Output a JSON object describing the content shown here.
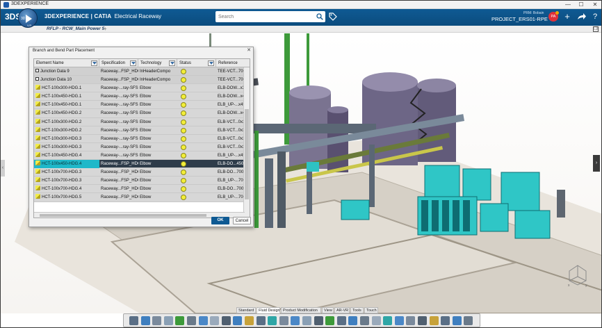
{
  "os": {
    "title": "3DEXPERIENCE",
    "minimize": "—",
    "maximize": "☐",
    "close": "✕"
  },
  "topbar": {
    "logo": "3DS",
    "compass_version": "3D",
    "compass_code": "V.R",
    "brand": "3DEXPERIENCE | CATIA",
    "app_name": "Electrical Raceway",
    "search_placeholder": "Search",
    "role": "PRM: Bobain",
    "project": "PROJECT_ERS01-RPE ▾",
    "avatar_initials": "PA"
  },
  "tab": {
    "title": "RFLP - RCW_Main Power 5",
    "add": "+"
  },
  "dialog": {
    "title": "Branch and Bend Part Placement",
    "close": "✕",
    "columns": [
      "Element Name",
      "Specification",
      "Technology",
      "Status",
      "Reference"
    ],
    "rows": [
      {
        "name": "Junction Data 9",
        "spec": "Raceway...FSP_HDG",
        "tech": "InHeaderCompo",
        "ref": "TEE-VCT...700-",
        "kind": "junction"
      },
      {
        "name": "Junction Data 10",
        "spec": "Raceway...FSP_HDG",
        "tech": "InHeaderCompo",
        "ref": "TEE-VCT...700-",
        "kind": "junction"
      },
      {
        "name": "HCT-100x300-HDG.1",
        "spec": "Raceway-...ray-SFSP",
        "tech": "Elbow",
        "ref": "ELB-DOW...x3(",
        "kind": "elbow"
      },
      {
        "name": "HCT-100x450-HDG.1",
        "spec": "Raceway-...ray-SFSP",
        "tech": "Elbow",
        "ref": "ELB-DOW...x45",
        "kind": "elbow"
      },
      {
        "name": "HCT-100x450-HDG.1",
        "spec": "Raceway-...ray-SFSP",
        "tech": "Elbow",
        "ref": "ELB_UP-...x450",
        "kind": "elbow"
      },
      {
        "name": "HCT-100x450-HDG.2",
        "spec": "Raceway-...ray-SFSP",
        "tech": "Elbow",
        "ref": "ELB-DOW...x45",
        "kind": "elbow"
      },
      {
        "name": "HCT-100x300-HDG.2",
        "spec": "Raceway-...ray-SFSP",
        "tech": "Elbow",
        "ref": "ELB-VCT...0x3C",
        "kind": "elbow"
      },
      {
        "name": "HCT-100x300-HDG.2",
        "spec": "Raceway-...ray-SFSP",
        "tech": "Elbow",
        "ref": "ELB-VCT...0x3C",
        "kind": "elbow"
      },
      {
        "name": "HCT-100x300-HDG.3",
        "spec": "Raceway-...ray-SFSP",
        "tech": "Elbow",
        "ref": "ELB-VCT...0x3C",
        "kind": "elbow"
      },
      {
        "name": "HCT-100x300-HDG.3",
        "spec": "Raceway-...ray-SFSP",
        "tech": "Elbow",
        "ref": "ELB-VCT...0x3C",
        "kind": "elbow"
      },
      {
        "name": "HCT-100x450-HDG.4",
        "spec": "Raceway-...ray-SFSP",
        "tech": "Elbow",
        "ref": "ELB_UP-...x450",
        "kind": "elbow"
      },
      {
        "name": "HCT-100x450-HDG.4",
        "spec": "Raceway...FSP_HDG",
        "tech": "Elbow",
        "ref": "ELB-DO...450-I",
        "kind": "elbow",
        "selected": true
      },
      {
        "name": "HCT-100x700-HDG.3",
        "spec": "Raceway...FSP_HDG",
        "tech": "Elbow",
        "ref": "ELB-DO...700-I",
        "kind": "elbow"
      },
      {
        "name": "HCT-100x700-HDG.3",
        "spec": "Raceway...FSP_HDG",
        "tech": "Elbow",
        "ref": "ELB_UP-...700-I",
        "kind": "elbow"
      },
      {
        "name": "HCT-100x700-HDG.4",
        "spec": "Raceway...FSP_HDG",
        "tech": "Elbow",
        "ref": "ELB-DO...700-I",
        "kind": "elbow"
      },
      {
        "name": "HCT-100x700-HDG.5",
        "spec": "Raceway...FSP_HDG",
        "tech": "Elbow",
        "ref": "ELB_UP-...700-I",
        "kind": "elbow"
      }
    ],
    "ok_label": "OK",
    "cancel_label": "Cancel"
  },
  "action_tabs": [
    "Standard",
    "Fluid Design",
    "Product Modification",
    "View",
    "AR-VR",
    "Tools",
    "Touch"
  ],
  "colors": {
    "brand": "#0f5a93",
    "selection": "#1fb8c9",
    "status": "#f2ee3a"
  },
  "icons": [
    "compass-icon",
    "search-icon",
    "tag-icon",
    "add-icon",
    "share-icon",
    "help-icon",
    "elbow-icon",
    "filter-icon"
  ]
}
